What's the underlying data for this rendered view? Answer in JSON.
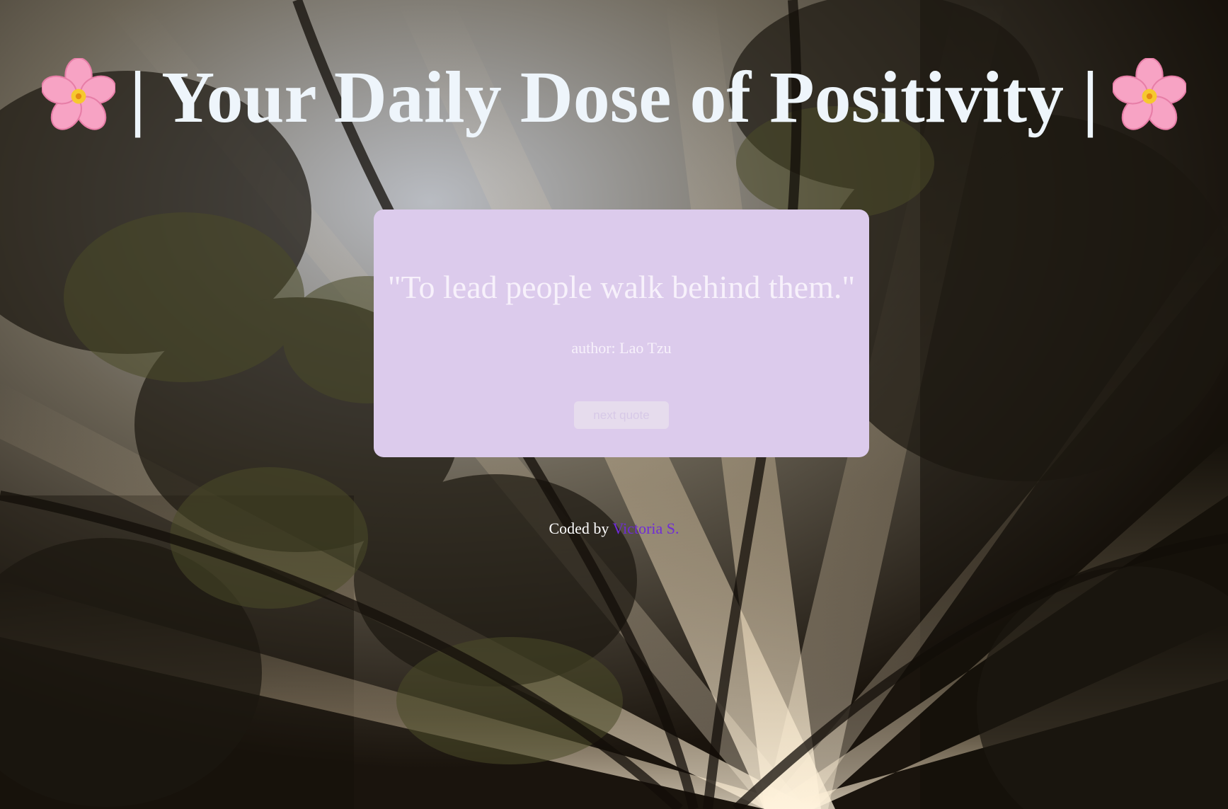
{
  "header": {
    "title": "| Your Daily Dose of Positivity |",
    "left_icon": "cherry-blossom-icon",
    "right_icon": "cherry-blossom-icon"
  },
  "quote": {
    "text": "\"To lead people walk behind them.\"",
    "author_line": "author: Lao Tzu",
    "next_button_label": "next quote"
  },
  "footer": {
    "prefix": "Coded by ",
    "link_text": "Victoria S."
  },
  "colors": {
    "card_background": "#dccbec",
    "title_text": "#eef5fb",
    "link": "#6f2bd8"
  }
}
